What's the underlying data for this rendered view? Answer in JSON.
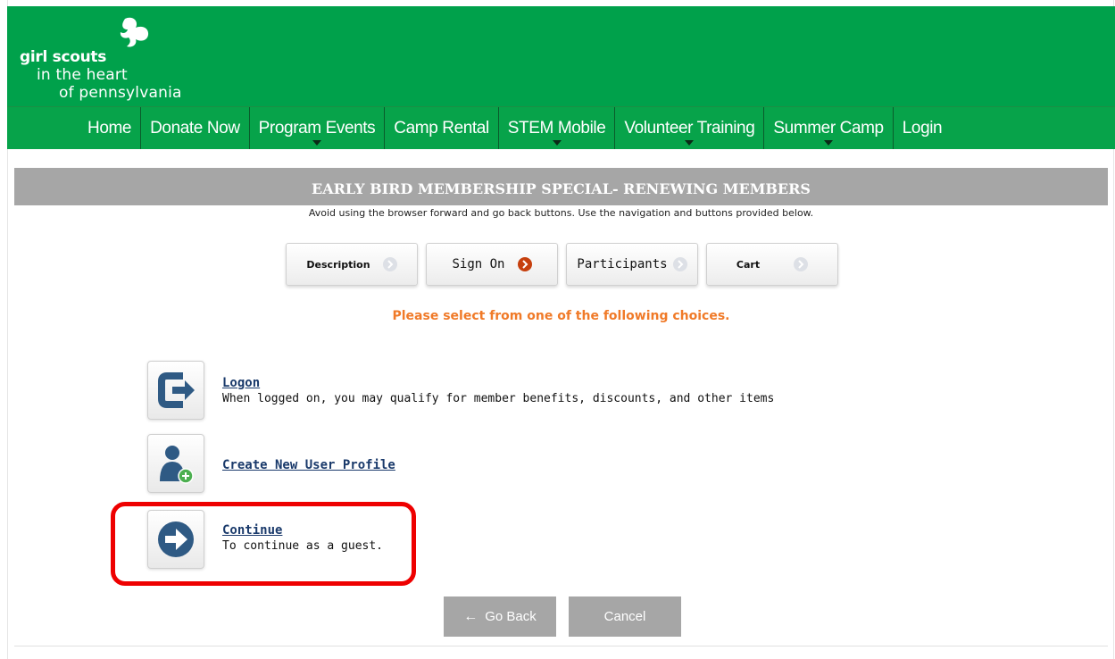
{
  "header": {
    "logo": {
      "line1": "girl scouts",
      "line2": "in the heart",
      "line3": "of pennsylvania"
    },
    "colors": {
      "brand": "#00a14b",
      "nav": "#07a34a",
      "caret": "#0b2a17"
    }
  },
  "nav": {
    "items": [
      {
        "label": "Home",
        "dropdown": false
      },
      {
        "label": "Donate Now",
        "dropdown": false
      },
      {
        "label": "Program Events",
        "dropdown": true
      },
      {
        "label": "Camp Rental",
        "dropdown": false
      },
      {
        "label": "STEM Mobile",
        "dropdown": true
      },
      {
        "label": "Volunteer Training",
        "dropdown": true
      },
      {
        "label": "Summer Camp",
        "dropdown": true
      },
      {
        "label": "Login",
        "dropdown": false
      }
    ]
  },
  "page": {
    "title": "EARLY BIRD MEMBERSHIP SPECIAL- RENEWING MEMBERS",
    "notice": "Avoid using the browser forward and go back buttons. Use the navigation and buttons provided below.",
    "prompt": "Please select from one of the following choices."
  },
  "steps": [
    {
      "label": "Description",
      "active": false,
      "icon": "chevron-right-icon"
    },
    {
      "label": "Sign On",
      "active": true,
      "icon": "chevron-right-icon"
    },
    {
      "label": "Participants",
      "active": false,
      "icon": "chevron-right-icon"
    },
    {
      "label": "Cart",
      "active": false,
      "icon": "chevron-right-icon"
    }
  ],
  "choices": {
    "logon": {
      "title": "Logon",
      "desc": "When logged on, you may qualify for member benefits, discounts, and other items",
      "icon": "logon-icon"
    },
    "create": {
      "title": "Create New User Profile",
      "icon": "add-user-icon"
    },
    "continue": {
      "title": "Continue",
      "desc": "To continue as a guest.",
      "icon": "arrow-right-icon"
    }
  },
  "buttons": {
    "go_back": "Go Back",
    "cancel": "Cancel"
  },
  "colors": {
    "accent_blue": "#2f5a84",
    "prompt_orange": "#f07a28",
    "active_step": "#c6400e",
    "highlight_red": "#ee0000",
    "button_gray": "#a6a6a6"
  }
}
